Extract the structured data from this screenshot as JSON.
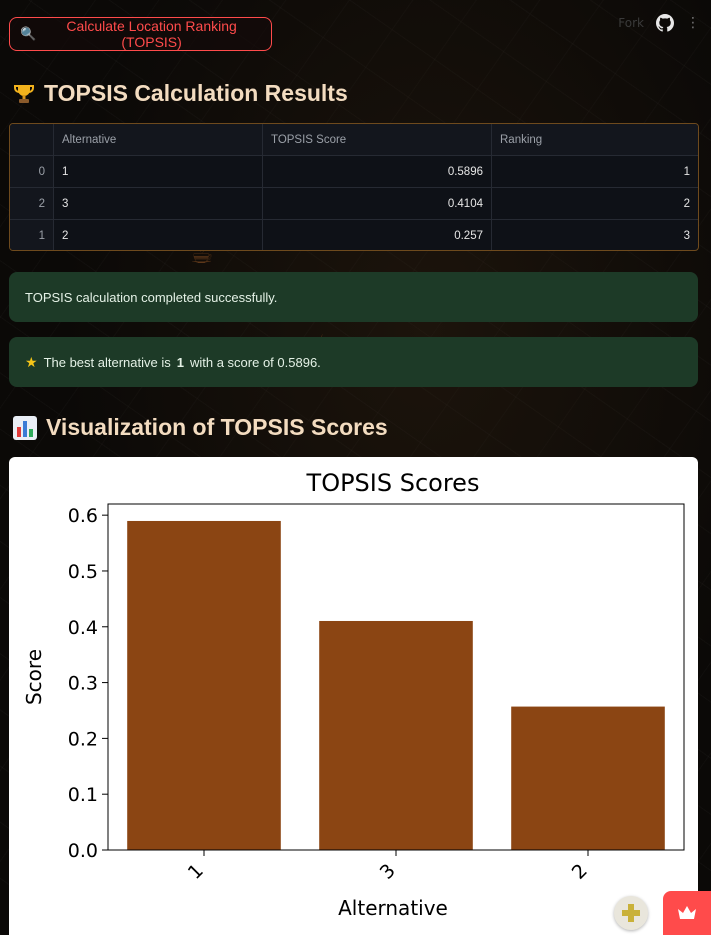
{
  "header": {
    "fork_label": "Fork",
    "icons": [
      "github-icon",
      "more-icon"
    ]
  },
  "calc_button": {
    "icon": "magnifier-icon",
    "label": "Calculate Location Ranking (TOPSIS)"
  },
  "results": {
    "icon": "trophy-icon",
    "title": "TOPSIS Calculation Results",
    "table": {
      "columns": [
        "",
        "Alternative",
        "TOPSIS Score",
        "Ranking"
      ],
      "rows": [
        {
          "index": "0",
          "alternative": "1",
          "score": "0.5896",
          "ranking": "1"
        },
        {
          "index": "2",
          "alternative": "3",
          "score": "0.4104",
          "ranking": "2"
        },
        {
          "index": "1",
          "alternative": "2",
          "score": "0.257",
          "ranking": "3"
        }
      ]
    }
  },
  "alerts": {
    "success": "TOPSIS calculation completed successfully.",
    "best_prefix": "The best alternative is",
    "best_alternative": "1",
    "best_suffix": "with a score of 0.5896."
  },
  "visualization": {
    "icon": "bar-chart-icon",
    "title": "Visualization of TOPSIS Scores"
  },
  "chart_data": {
    "type": "bar",
    "title": "TOPSIS Scores",
    "xlabel": "Alternative",
    "ylabel": "Score",
    "categories": [
      "1",
      "3",
      "2"
    ],
    "values": [
      0.5896,
      0.4104,
      0.257
    ],
    "ylim": [
      0,
      0.62
    ],
    "yticks": [
      0.0,
      0.1,
      0.2,
      0.3,
      0.4,
      0.5,
      0.6
    ],
    "ytick_labels": [
      "0.0",
      "0.1",
      "0.2",
      "0.3",
      "0.4",
      "0.5",
      "0.6"
    ],
    "bar_color": "#8b4513",
    "grid": false
  },
  "colors": {
    "accent": "#ff4b4b",
    "heading": "#f3dcc0",
    "success_bg": "#1d3a27"
  }
}
